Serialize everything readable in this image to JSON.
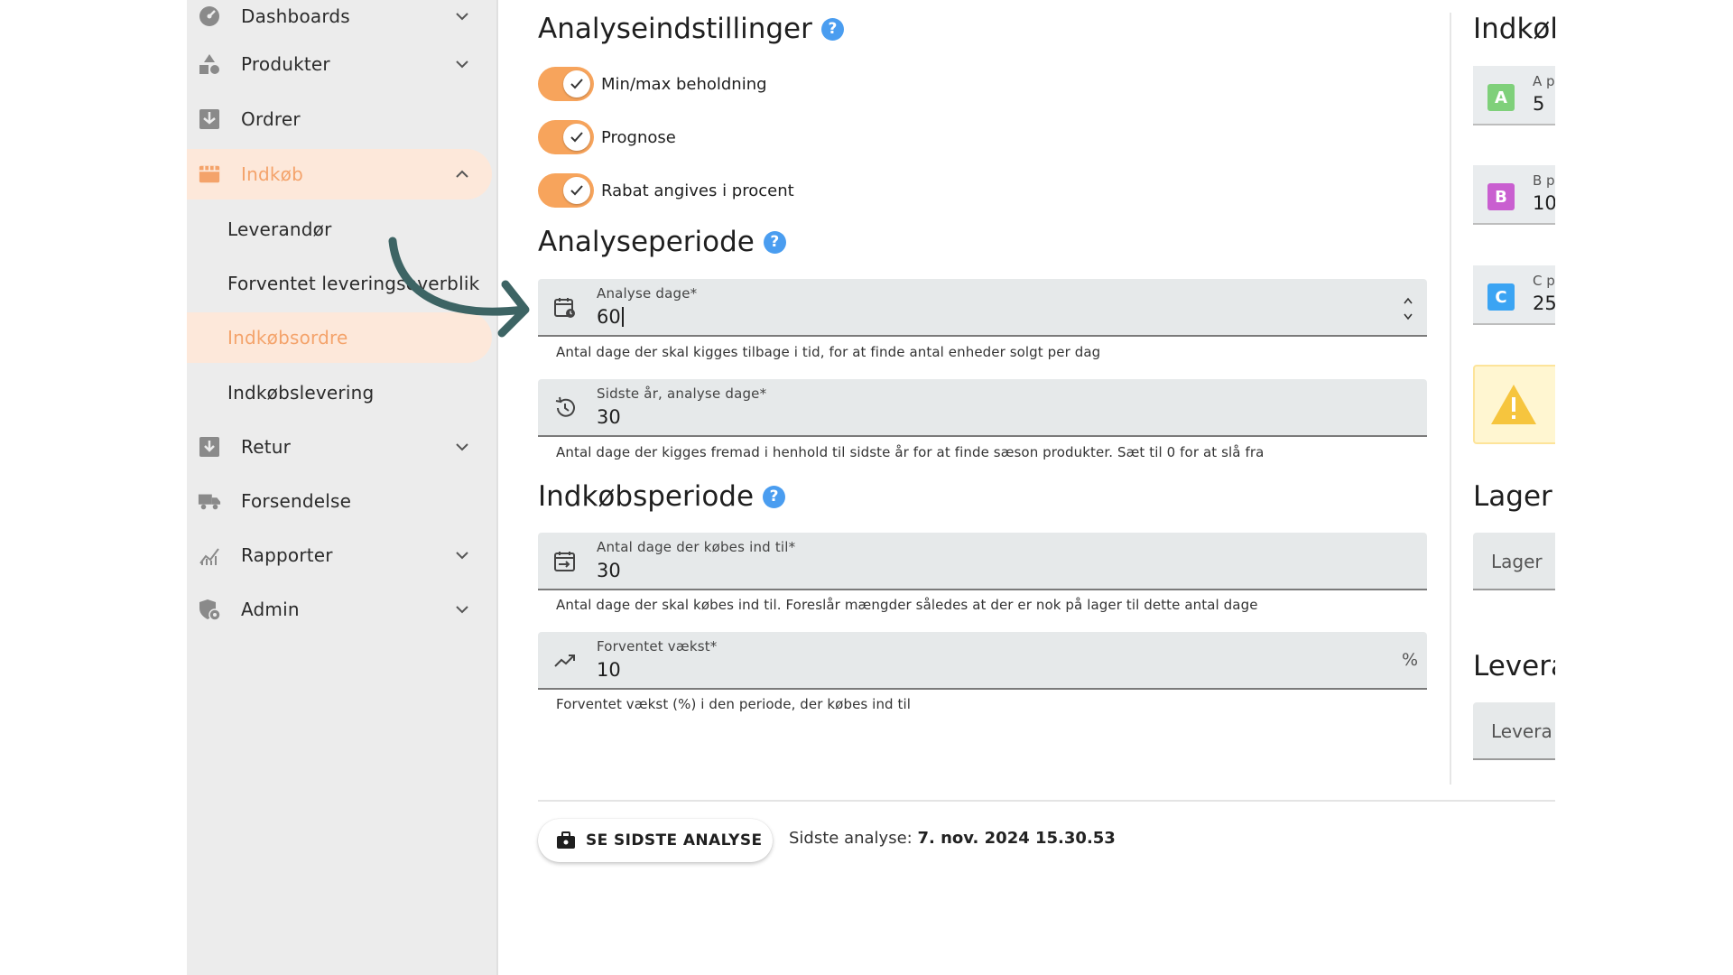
{
  "sidebar": {
    "items": [
      {
        "label": "Dashboards",
        "icon": "dashboard-icon",
        "expandable": true
      },
      {
        "label": "Produkter",
        "icon": "shapes-icon",
        "expandable": true
      },
      {
        "label": "Ordrer",
        "icon": "inbox-icon",
        "expandable": false
      },
      {
        "label": "Indkøb",
        "icon": "store-icon",
        "expandable": true,
        "expanded": true,
        "active": true
      },
      {
        "label": "Retur",
        "icon": "return-box-icon",
        "expandable": true
      },
      {
        "label": "Forsendelse",
        "icon": "truck-icon",
        "expandable": false
      },
      {
        "label": "Rapporter",
        "icon": "chart-icon",
        "expandable": true
      },
      {
        "label": "Admin",
        "icon": "admin-shield-icon",
        "expandable": true
      }
    ],
    "subitems": [
      {
        "label": "Leverandør"
      },
      {
        "label": "Forventet leveringsoverblik"
      },
      {
        "label": "Indkøbsordre",
        "active": true
      },
      {
        "label": "Indkøbslevering"
      }
    ]
  },
  "settings": {
    "title": "Analyseindstillinger",
    "toggles": [
      {
        "label": "Min/max beholdning",
        "on": true
      },
      {
        "label": "Prognose",
        "on": true
      },
      {
        "label": "Rabat angives i procent",
        "on": true
      }
    ]
  },
  "analysis_period": {
    "title": "Analyseperiode",
    "fields": [
      {
        "label": "Analyse dage*",
        "value": "60",
        "helper": "Antal dage der skal kigges tilbage i tid, for at finde antal enheder solgt per dag",
        "icon": "calendar-clock-icon"
      },
      {
        "label": "Sidste år, analyse dage*",
        "value": "30",
        "helper": "Antal dage der kigges fremad i henhold til sidste år for at finde sæson produkter. Sæt til 0 for at slå fra",
        "icon": "history-icon"
      }
    ]
  },
  "purchase_period": {
    "title": "Indkøbsperiode",
    "fields": [
      {
        "label": "Antal dage der købes ind til*",
        "value": "30",
        "helper": "Antal dage der skal købes ind til. Foreslår mængder således at der er nok på lager til dette antal dage",
        "icon": "calendar-arrow-icon"
      },
      {
        "label": "Forventet vækst*",
        "value": "10",
        "suffix": "%",
        "helper": "Forventet vækst (%) i den periode, der købes ind til",
        "icon": "trending-up-icon"
      }
    ]
  },
  "footer": {
    "button_label": "SE SIDSTE ANALYSE",
    "last_analysis_label": "Sidste analyse:",
    "last_analysis_value": "7. nov. 2024 15.30.53"
  },
  "right_panel": {
    "title": "Indkøb",
    "cards": [
      {
        "badge": "A",
        "small": "A p",
        "value": "5",
        "color": "#7fd07a"
      },
      {
        "badge": "B",
        "small": "B p",
        "value": "10",
        "color": "#c95fd0"
      },
      {
        "badge": "C",
        "small": "C p",
        "value": "25",
        "color": "#3ba4f3"
      }
    ],
    "lager_title": "Lager",
    "lager_field": "Lager",
    "leverandor_title": "Levera",
    "leverandor_field": "Levera"
  },
  "colors": {
    "accent": "#f7a45c",
    "active_bg": "#fde8da",
    "active_text": "#f4a36b",
    "help": "#4a9df0",
    "warning": "#f6c53e",
    "arrow": "#3d6464"
  }
}
